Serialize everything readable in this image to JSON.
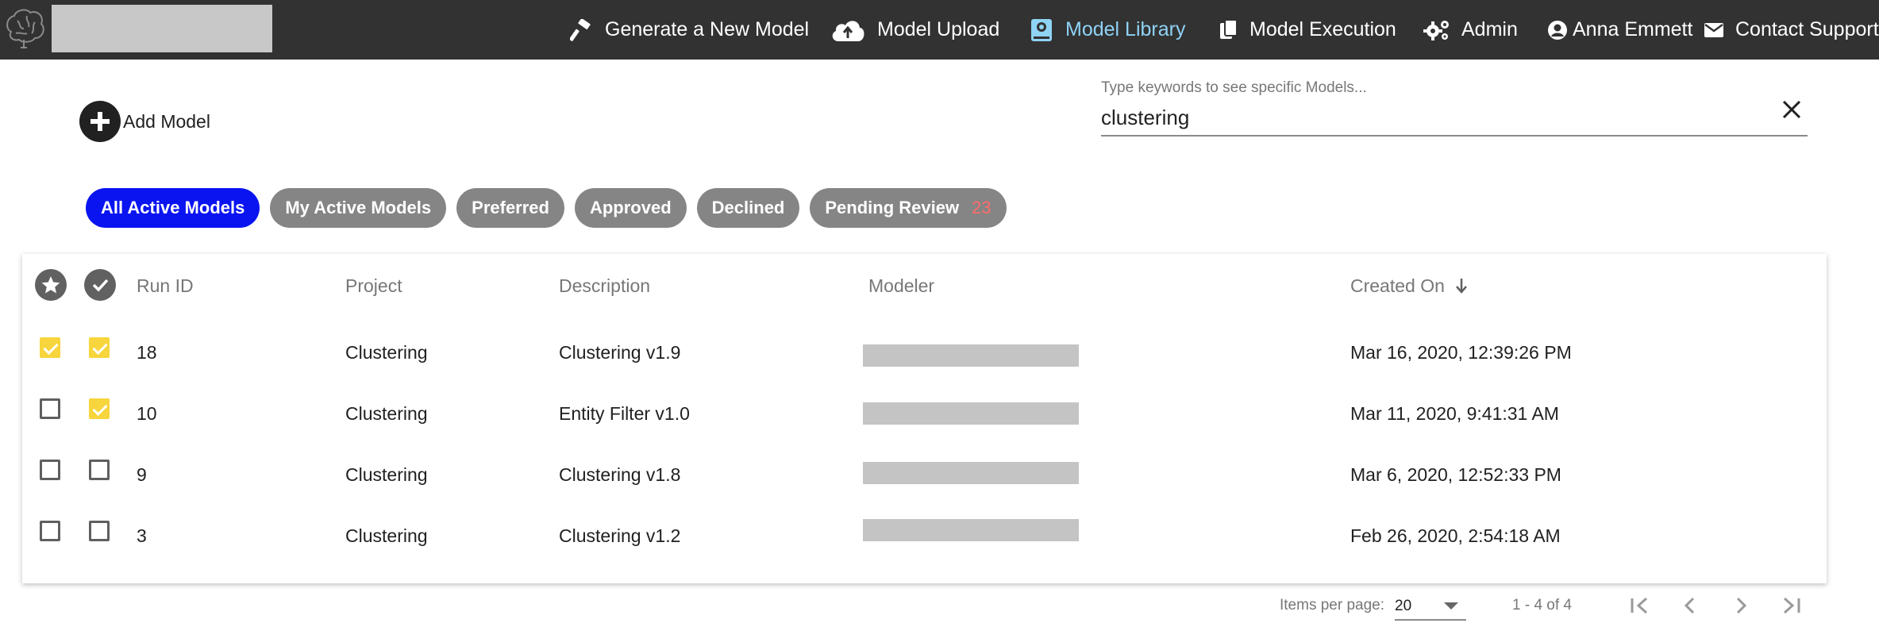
{
  "nav": {
    "items": [
      {
        "label": "Generate a New Model",
        "icon": "hammer-icon"
      },
      {
        "label": "Model Upload",
        "icon": "cloud-upload-icon"
      },
      {
        "label": "Model Library",
        "icon": "book-icon",
        "active": true
      },
      {
        "label": "Model Execution",
        "icon": "copy-icon"
      },
      {
        "label": "Admin",
        "icon": "gears-icon"
      },
      {
        "label": "Anna Emmett",
        "icon": "user-circle-icon"
      },
      {
        "label": "Contact Support",
        "icon": "envelope-icon"
      }
    ],
    "active_color": "#8fd3f5",
    "background": "#323232"
  },
  "actions": {
    "add_model_label": "Add Model"
  },
  "search": {
    "label": "Type keywords to see specific Models...",
    "value": "clustering"
  },
  "filters": {
    "chips": [
      {
        "label": "All Active Models",
        "active": true
      },
      {
        "label": "My Active Models"
      },
      {
        "label": "Preferred"
      },
      {
        "label": "Approved"
      },
      {
        "label": "Declined"
      },
      {
        "label": "Pending Review",
        "count": "23"
      }
    ],
    "active_color": "#0a14f0"
  },
  "table": {
    "headers": {
      "preferred_icon": "star-icon",
      "approved_icon": "check-circle-icon",
      "run_id": "Run ID",
      "project": "Project",
      "description": "Description",
      "modeler": "Modeler",
      "created_on": "Created On",
      "sort": "descending"
    },
    "rows": [
      {
        "preferred": true,
        "approved": true,
        "run_id": "18",
        "project": "Clustering",
        "description": "Clustering v1.9",
        "created_on": "Mar 16, 2020, 12:39:26 PM"
      },
      {
        "preferred": false,
        "approved": true,
        "run_id": "10",
        "project": "Clustering",
        "description": "Entity Filter v1.0",
        "created_on": "Mar 11, 2020, 9:41:31 AM"
      },
      {
        "preferred": false,
        "approved": false,
        "run_id": "9",
        "project": "Clustering",
        "description": "Clustering v1.8",
        "created_on": "Mar 6, 2020, 12:52:33 PM"
      },
      {
        "preferred": false,
        "approved": false,
        "run_id": "3",
        "project": "Clustering",
        "description": "Clustering v1.2",
        "created_on": "Feb 26, 2020, 2:54:18 AM"
      }
    ],
    "checkbox_color": "#f7d53c"
  },
  "pagination": {
    "items_per_page_label": "Items per page:",
    "items_per_page": "20",
    "range": "1 - 4 of 4"
  }
}
